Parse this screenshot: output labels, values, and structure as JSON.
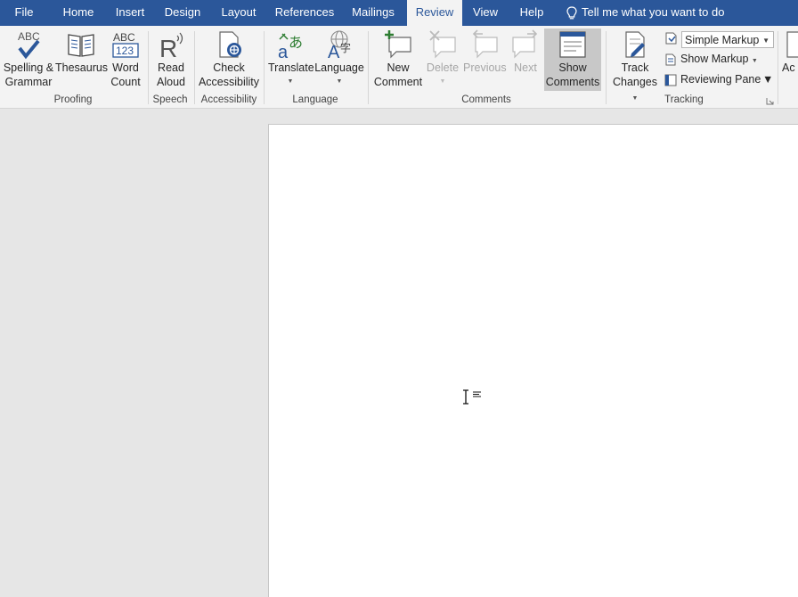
{
  "tabs": {
    "file": "File",
    "home": "Home",
    "insert": "Insert",
    "design": "Design",
    "layout": "Layout",
    "references": "References",
    "mailings": "Mailings",
    "review": "Review",
    "view": "View",
    "help": "Help"
  },
  "tell_me": "Tell me what you want to do",
  "active_tab": "Review",
  "proofing": {
    "group": "Proofing",
    "spelling_line1": "Spelling &",
    "spelling_line2": "Grammar",
    "thesaurus": "Thesaurus",
    "word_count_line1": "Word",
    "word_count_line2": "Count",
    "abc": "ABC",
    "n123": "123"
  },
  "speech": {
    "group": "Speech",
    "read_line1": "Read",
    "read_line2": "Aloud"
  },
  "accessibility": {
    "group": "Accessibility",
    "check_line1": "Check",
    "check_line2": "Accessibility"
  },
  "language": {
    "group": "Language",
    "translate": "Translate",
    "language": "Language"
  },
  "comments": {
    "group": "Comments",
    "new_line1": "New",
    "new_line2": "Comment",
    "delete": "Delete",
    "previous": "Previous",
    "next": "Next",
    "show_line1": "Show",
    "show_line2": "Comments"
  },
  "tracking": {
    "group": "Tracking",
    "track_line1": "Track",
    "track_line2": "Changes",
    "markup_select": "Simple Markup",
    "show_markup": "Show Markup",
    "reviewing_pane": "Reviewing Pane",
    "cutoff_label": "Ac"
  },
  "colors": {
    "brand": "#2b579a",
    "ribbon_bg": "#f3f3f3",
    "canvas_bg": "#e6e6e6",
    "disabled": "#a6a6a6"
  }
}
